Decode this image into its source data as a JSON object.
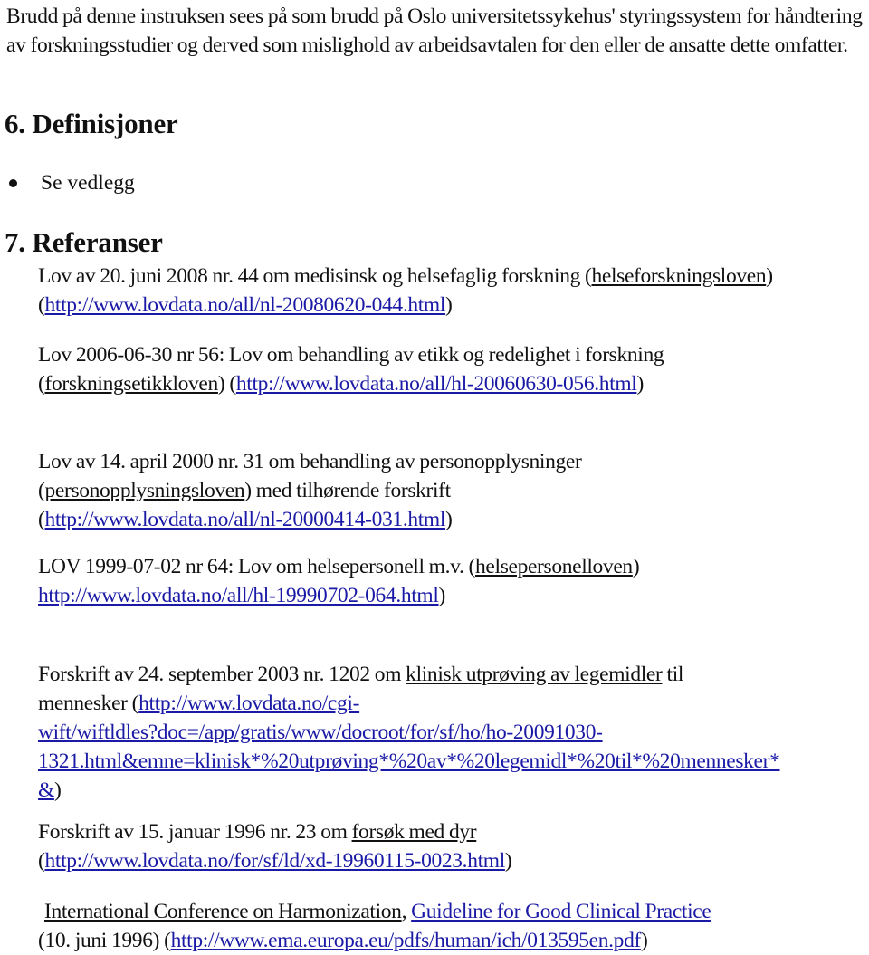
{
  "intro": {
    "text": "Brudd på denne instruksen sees på som brudd på Oslo universitetssykehus' styringssystem for håndtering av forskningsstudier og derved som mislighold av arbeidsavtalen for den eller de ansatte dette omfatter."
  },
  "section6": {
    "heading": "6. Definisjoner",
    "bullets": [
      "Se vedlegg"
    ]
  },
  "section7": {
    "heading": "7. Referanser",
    "references": [
      {
        "pre": "Lov av 20. juni 2008 nr. 44 om medisinsk og helsefaglig forskning (",
        "underlined": "helseforskningsloven",
        "mid": ") (",
        "link": "http://www.lovdata.no/all/nl-20080620-044.html",
        "post": ")"
      },
      {
        "pre": "Lov 2006-06-30 nr 56: Lov om behandling av etikk og redelighet i forskning (",
        "underlined": "forskningsetikkloven",
        "mid": ") (",
        "link": "http://www.lovdata.no/all/hl-20060630-056.html",
        "post": ")"
      },
      {
        "pre": "Lov av 14. april 2000 nr. 31 om behandling av personopplysninger (",
        "underlined": "personopplysningsloven",
        "mid": ") med tilhørende forskrift (",
        "link": "http://www.lovdata.no/all/nl-20000414-031.html",
        "post": ")"
      },
      {
        "pre": "LOV 1999-07-02 nr 64: Lov om helsepersonell m.v. (",
        "underlined": "helsepersonelloven",
        "mid": ") ",
        "link": "http://www.lovdata.no/all/hl-19990702-064.html",
        "post": ")"
      },
      {
        "pre": "Forskrift av 24. september 2003 nr. 1202 om ",
        "underlined": "klinisk utprøving av legemidler",
        "mid": " til mennesker (",
        "link_lines": [
          "http://www.lovdata.no/cgi-",
          "wift/wiftldles?doc=/app/gratis/www/docroot/for/sf/ho/ho-20091030-",
          "1321.html&emne=klinisk*%20utprøving*%20av*%20legemidl*%20til*%20mennesker*",
          "&"
        ],
        "post": ")"
      },
      {
        "pre": "Forskrift av 15. januar 1996 nr. 23 om ",
        "underlined": "forsøk med dyr",
        "mid": " (",
        "link": "http://www.lovdata.no/for/sf/ld/xd-19960115-0023.html",
        "post": ")"
      },
      {
        "underlined": "International Conference on Harmonization",
        "sep": ", ",
        "guideline_link": "Guideline for Good Clinical Practice",
        "mid": " (10. juni 1996) (",
        "link": "http://www.ema.europa.eu/pdfs/human/ich/013595en.pdf",
        "post": ")"
      }
    ]
  },
  "colors": {
    "text": "#111111",
    "link": "#1a1aa6",
    "background": "#ffffff"
  }
}
